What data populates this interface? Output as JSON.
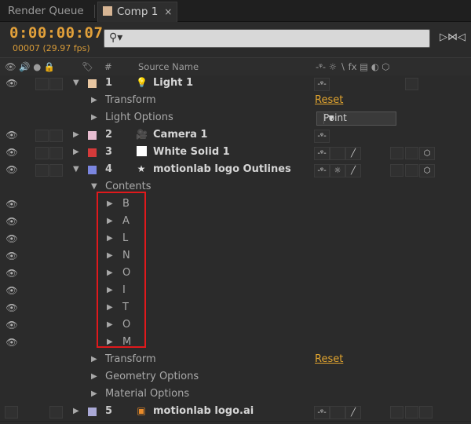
{
  "tabs": {
    "render_queue": "Render Queue",
    "comp": "Comp 1",
    "close": "×"
  },
  "time": {
    "timecode": "0:00:00:07",
    "frames": "00007 (29.97 fps)"
  },
  "search": {
    "value": "",
    "placeholder": ""
  },
  "columns": {
    "label": "#",
    "source_name": "Source Name",
    "switches": "-ᵠ- ☼ ∖ fx ▤ ◐ ⬡"
  },
  "layers": [
    {
      "num": "1",
      "name": "Light 1",
      "color": "#e9c7a2",
      "icon": "light-bulb-icon",
      "expanded": true
    },
    {
      "num": "2",
      "name": "Camera 1",
      "color": "#e7bdd1",
      "icon": "camera-icon",
      "expanded": false
    },
    {
      "num": "3",
      "name": "White Solid 1",
      "color": "#d43a3a",
      "icon": "solid-icon",
      "expanded": false
    },
    {
      "num": "4",
      "name": "motionlab logo Outlines",
      "color": "#7b86e0",
      "icon": "star-icon",
      "expanded": true
    },
    {
      "num": "5",
      "name": "motionlab logo.ai",
      "color": "#aaa9d6",
      "icon": "footage-icon",
      "expanded": false
    }
  ],
  "props": {
    "transform": "Transform",
    "light_options": "Light Options",
    "contents": "Contents",
    "geometry_options": "Geometry Options",
    "material_options": "Material Options",
    "reset": "Reset",
    "light_type": "Point"
  },
  "content_items": [
    "B",
    "A",
    "L",
    "N",
    "O",
    "I",
    "T",
    "O",
    "M"
  ],
  "colors": {
    "accent": "#e3a13a",
    "highlight_box": "#e0191c"
  }
}
